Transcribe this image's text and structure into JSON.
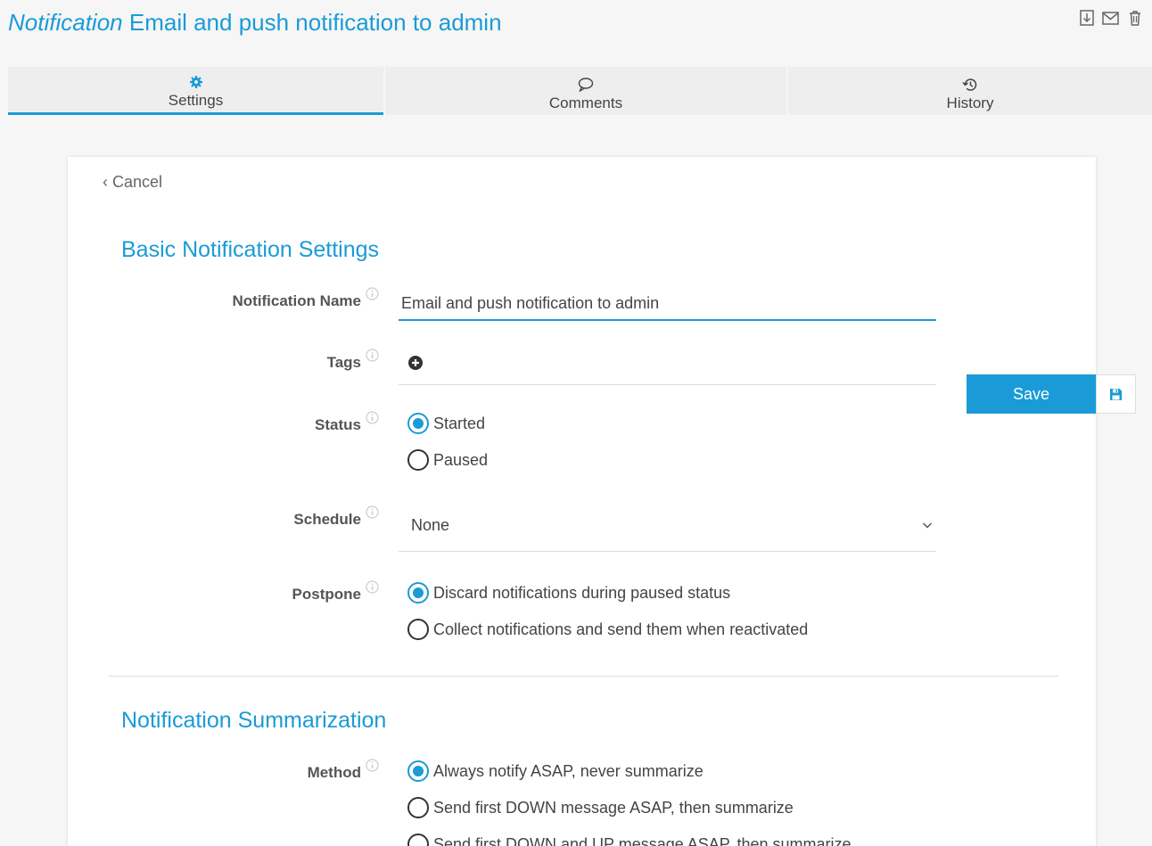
{
  "header": {
    "kind": "Notification",
    "title": "Email and push notification to admin",
    "icons": [
      "export-icon",
      "mail-icon",
      "trash-icon"
    ]
  },
  "tabs": [
    {
      "label": "Settings",
      "icon": "gear-icon",
      "active": true
    },
    {
      "label": "Comments",
      "icon": "comment-icon",
      "active": false
    },
    {
      "label": "History",
      "icon": "history-icon",
      "active": false
    }
  ],
  "cancel_label": "Cancel",
  "basic": {
    "heading": "Basic Notification Settings",
    "name_label": "Notification Name",
    "name_value": "Email and push notification to admin",
    "tags_label": "Tags",
    "status_label": "Status",
    "status_options": [
      "Started",
      "Paused"
    ],
    "status_selected": "Started",
    "schedule_label": "Schedule",
    "schedule_value": "None",
    "postpone_label": "Postpone",
    "postpone_options": [
      "Discard notifications during paused status",
      "Collect notifications and send them when reactivated"
    ],
    "postpone_selected": "Discard notifications during paused status"
  },
  "summarization": {
    "heading": "Notification Summarization",
    "method_label": "Method",
    "method_options": [
      "Always notify ASAP, never summarize",
      "Send first DOWN message ASAP, then summarize",
      "Send first DOWN and UP message ASAP, then summarize"
    ],
    "method_selected": "Always notify ASAP, never summarize"
  },
  "save_label": "Save",
  "colors": {
    "accent": "#1a9bd7",
    "background": "#f6f6f6",
    "text": "#444444"
  }
}
